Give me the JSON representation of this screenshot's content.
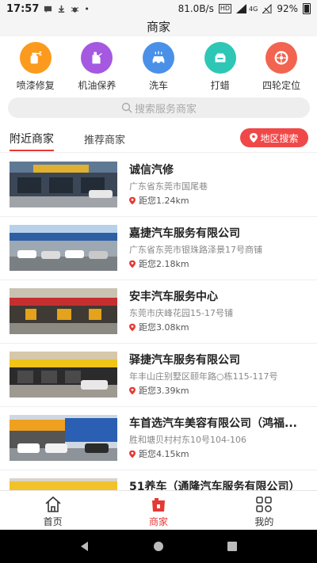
{
  "status_bar": {
    "time": "17:57",
    "speed": "81.0B/s",
    "network_badge": "HD",
    "signal": "4G",
    "battery": "92%"
  },
  "title": "商家",
  "categories": [
    {
      "label": "喷漆修复",
      "icon": "spray-paint-icon",
      "color": "#fb9a1c"
    },
    {
      "label": "机油保养",
      "icon": "oil-can-icon",
      "color": "#a558e0"
    },
    {
      "label": "洗车",
      "icon": "car-wash-icon",
      "color": "#4a90e8"
    },
    {
      "label": "打蜡",
      "icon": "wax-icon",
      "color": "#2ec7b6"
    },
    {
      "label": "四轮定位",
      "icon": "wheel-icon",
      "color": "#f26450"
    }
  ],
  "search": {
    "placeholder": "搜索服务商家"
  },
  "tabs": {
    "nearby": "附近商家",
    "recommended": "推荐商家"
  },
  "region_search_label": "地区搜索",
  "shops": [
    {
      "name": "诚信汽修",
      "address": "广东省东莞市国尾巷",
      "distance": "距您1.24km"
    },
    {
      "name": "嘉捷汽车服务有限公司",
      "address": "广东省东莞市银珠路泽景17号商铺",
      "distance": "距您2.18km"
    },
    {
      "name": "安丰汽车服务中心",
      "address": "东莞市庆峰花园15-17号铺",
      "distance": "距您3.08km"
    },
    {
      "name": "驿捷汽车服务有限公司",
      "address": "年丰山庄别墅区颐年路○栋115-117号",
      "distance": "距您3.39km"
    },
    {
      "name": "车首选汽车美容有限公司（鸿福...",
      "address": "胜和塘贝村村东10号104-106",
      "distance": "距您4.15km"
    },
    {
      "name": "51养车（通隆汽车服务有限公司）",
      "address": "",
      "distance": ""
    }
  ],
  "bottom_tabs": [
    {
      "label": "首页",
      "icon": "home-icon"
    },
    {
      "label": "商家",
      "icon": "shop-icon"
    },
    {
      "label": "我的",
      "icon": "profile-grid-icon"
    }
  ],
  "colors": {
    "accent": "#e53935",
    "region_button": "#f04848"
  }
}
